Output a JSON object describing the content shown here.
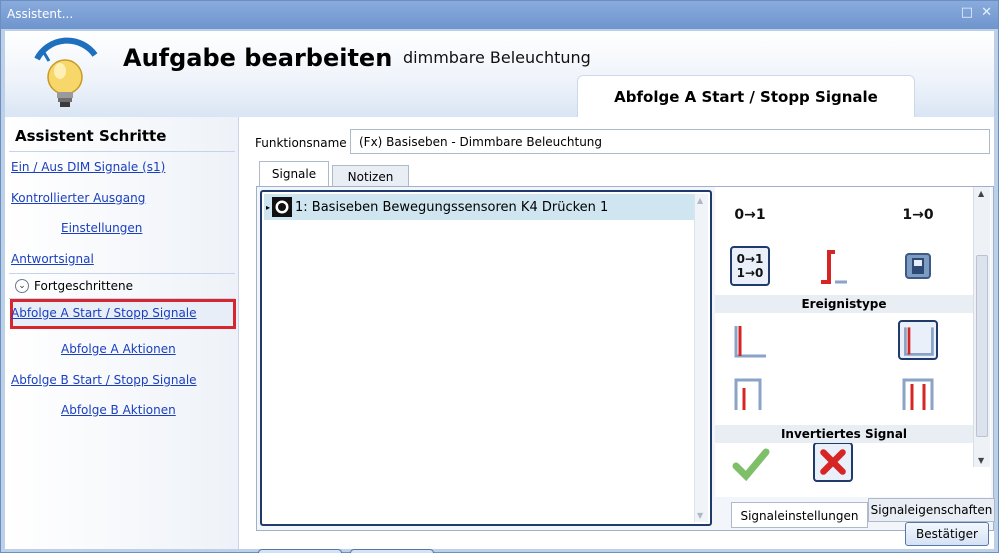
{
  "window": {
    "title": "Assistent...",
    "controls": "□ ✕"
  },
  "header": {
    "title": "Aufgabe bearbeiten",
    "subtitle": "dimmbare Beleuchtung",
    "tab": "Abfolge A Start / Stopp Signale",
    "icon": "lightbulb-icon"
  },
  "sidebar": {
    "title": "Assistent Schritte",
    "items": [
      {
        "label": "Ein / Aus DIM Signale (s1)"
      },
      {
        "label": "Kontrollierter Ausgang"
      },
      {
        "label": "Einstellungen"
      },
      {
        "label": "Antwortsignal"
      },
      {
        "label": "Fortgeschrittene"
      },
      {
        "label": "Abfolge A Start / Stopp Signale"
      },
      {
        "label": "Abfolge A Aktionen"
      },
      {
        "label": "Abfolge B Start / Stopp Signale"
      },
      {
        "label": "Abfolge B Aktionen"
      }
    ],
    "selected_color": "#d7262d"
  },
  "form": {
    "function_name_label": "Funktionsname",
    "function_name_value": "(Fx) Basiseben - Dimmbare Beleuchtung",
    "tabs": [
      {
        "label": "Signale"
      },
      {
        "label": "Notizen"
      }
    ]
  },
  "signals": {
    "rows": [
      {
        "label": "1: Basiseben Bewegungssensoren K4 Drücken 1"
      }
    ]
  },
  "properties": {
    "transition_up": "0→1",
    "transition_down": "1→0",
    "transition_both_top": "0→1",
    "transition_both_bottom": "1→0",
    "event_type_header": "Ereignistype",
    "inverted_header": "Invertiertes Signal",
    "tabs": [
      {
        "label": "Signaleinstellungen"
      },
      {
        "label": "Signaleigenschaften"
      }
    ]
  },
  "nav": {
    "prev": "<<<",
    "next": ">>>",
    "confirm": "Bestätiger"
  }
}
